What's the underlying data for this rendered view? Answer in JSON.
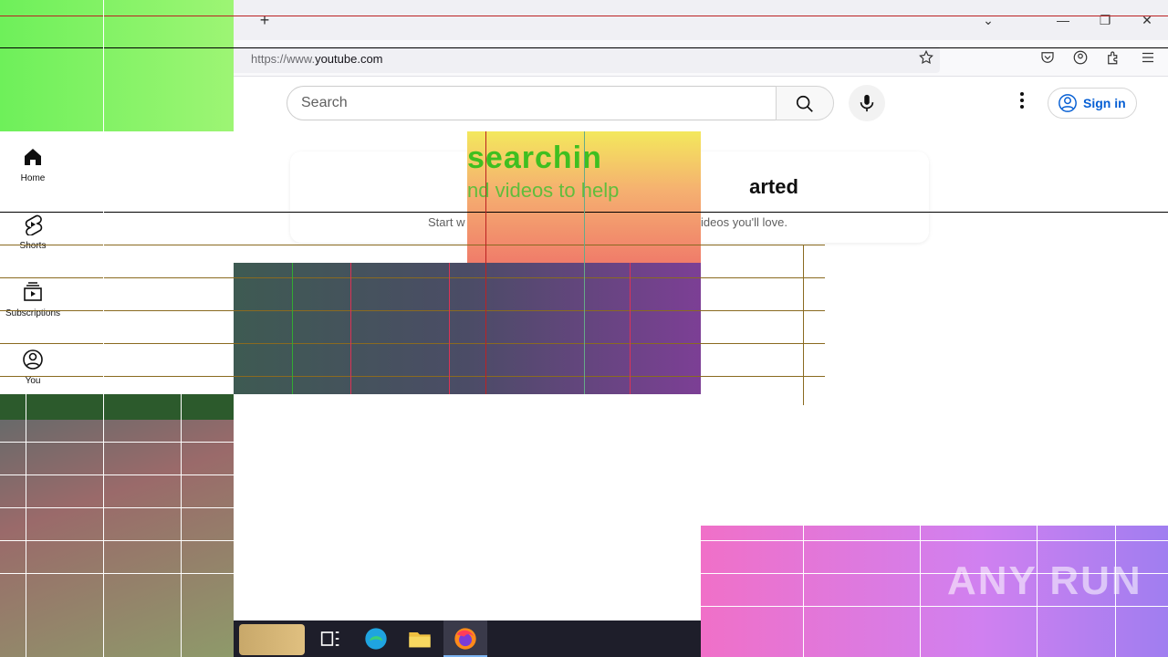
{
  "browser": {
    "new_tab_symbol": "+",
    "url_prefix": "https://www.",
    "url_domain": "youtube.com",
    "tab_list_symbol": "⌄",
    "minimize_symbol": "—",
    "restore_symbol": "❐",
    "close_symbol": "✕"
  },
  "youtube": {
    "search_placeholder": "Search",
    "sign_in_label": "Sign in",
    "nav": [
      {
        "label": "Home"
      },
      {
        "label": "Shorts"
      },
      {
        "label": "Subscriptions"
      },
      {
        "label": "You"
      }
    ],
    "card": {
      "title": "arted",
      "subtitle_left": "Start w",
      "subtitle_right": "ideos you'll love."
    },
    "glitch_text_1": "searchin",
    "glitch_text_2": "nd videos to help"
  },
  "watermark": "ANY RUN",
  "colors": {
    "accent_blue": "#065fd4",
    "taskbar_bg": "#1e1e2a"
  }
}
